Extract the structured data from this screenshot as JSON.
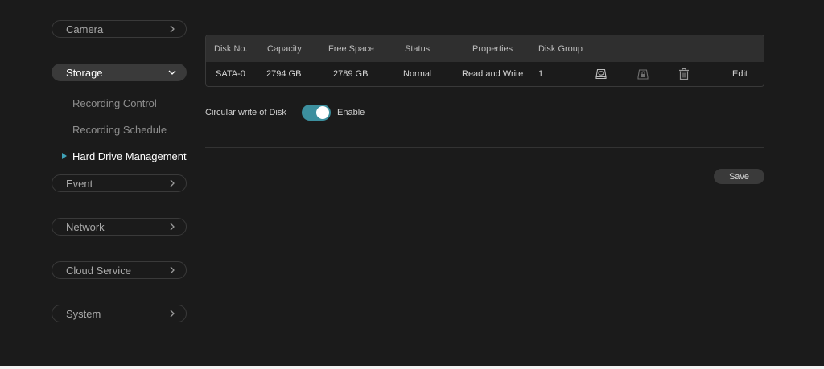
{
  "sidebar": {
    "camera": "Camera",
    "storage": "Storage",
    "storage_items": [
      "Recording Control",
      "Recording Schedule",
      "Hard Drive Management"
    ],
    "event": "Event",
    "network": "Network",
    "cloud_service": "Cloud Service",
    "system": "System"
  },
  "table": {
    "headers": [
      "Disk No.",
      "Capacity",
      "Free Space",
      "Status",
      "Properties",
      "Disk Group"
    ],
    "rows": [
      {
        "disk_no": "SATA-0",
        "capacity": "2794 GB",
        "free_space": "2789 GB",
        "status": "Normal",
        "properties": "Read and Write",
        "disk_group": "1",
        "edit": "Edit"
      }
    ],
    "icons": [
      "format-disk-icon",
      "lock-disk-icon",
      "delete-icon"
    ]
  },
  "circular_write": {
    "label": "Circular write of Disk",
    "state_label": "Enable",
    "enabled": true
  },
  "save_label": "Save",
  "colors": {
    "accent": "#3fa2b7",
    "toggle_on": "#3c8f9e"
  }
}
